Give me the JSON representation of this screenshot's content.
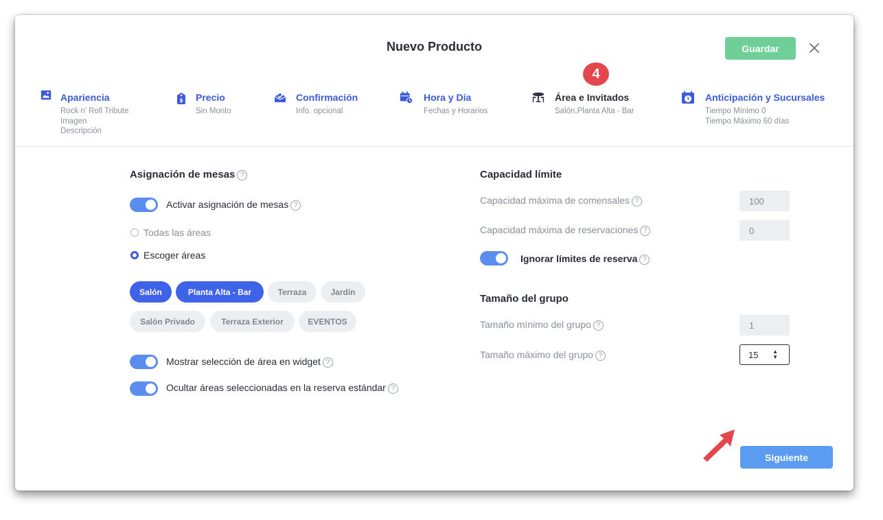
{
  "header": {
    "title": "Nuevo Producto",
    "save_label": "Guardar",
    "step_badge": "4"
  },
  "steps": [
    {
      "label": "Apariencia",
      "icon": "image-icon",
      "sub": [
        "Rock n' Roll Tribute",
        "Imagen",
        "Descripción"
      ]
    },
    {
      "label": "Precio",
      "icon": "price-tag-icon",
      "sub": [
        "Sin Monto"
      ]
    },
    {
      "label": "Confirmación",
      "icon": "envelope-check-icon",
      "sub": [
        "Info. opcional"
      ]
    },
    {
      "label": "Hora y Día",
      "icon": "calendar-clock-icon",
      "sub": [
        "Fechas y Horarios"
      ]
    },
    {
      "label": "Área e Invitados",
      "icon": "table-chairs-icon",
      "sub": [
        "Salón,Planta Alta - Bar"
      ]
    },
    {
      "label": "Anticipación y Sucursales",
      "icon": "calendar-timer-icon",
      "sub": [
        "Tiempo Mínimo 0",
        "Tiempo Máximo 60 días"
      ]
    }
  ],
  "table_assignment": {
    "title": "Asignación de mesas",
    "activate_label": "Activar asignación de mesas",
    "radio_all": "Todas las áreas",
    "radio_choose": "Escoger áreas",
    "areas": [
      {
        "label": "Salón",
        "selected": true
      },
      {
        "label": "Planta Alta - Bar",
        "selected": true
      },
      {
        "label": "Terraza",
        "selected": false
      },
      {
        "label": "Jardín",
        "selected": false
      },
      {
        "label": "Salón Privado",
        "selected": false
      },
      {
        "label": "Terraza Exterior",
        "selected": false
      },
      {
        "label": "EVENTOS",
        "selected": false
      }
    ],
    "show_widget_label": "Mostrar selección de área en widget",
    "hide_selected_label": "Ocultar áreas seleccionadas en la reserva estándar"
  },
  "capacity": {
    "title": "Capacidad límite",
    "max_guests_label": "Capacidad máxima de comensales",
    "max_guests_value": "100",
    "max_reservations_label": "Capacidad máxima de reservaciones",
    "max_reservations_value": "0",
    "ignore_limits_label": "Ignorar límites de reserva"
  },
  "group_size": {
    "title": "Tamaño del grupo",
    "min_label": "Tamaño mínimo del grupo",
    "min_value": "1",
    "max_label": "Tamaño máximo del grupo",
    "max_value": "15"
  },
  "footer": {
    "next_label": "Siguiente"
  },
  "help_glyph": "?",
  "colors": {
    "accent": "#3f63e8",
    "toggle": "#5b8def",
    "save": "#6ecf97",
    "next": "#5b9cf0",
    "badge": "#e4474b"
  }
}
